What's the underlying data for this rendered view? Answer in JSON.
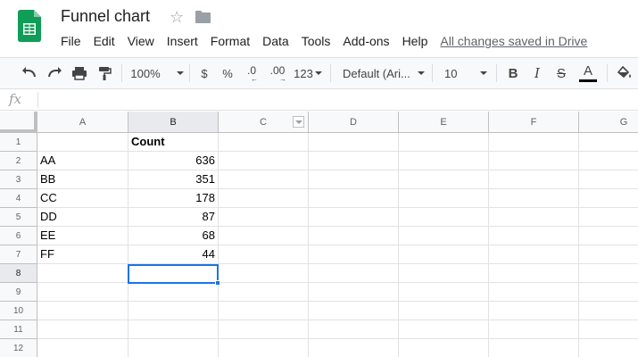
{
  "document": {
    "title": "Funnel chart",
    "saved_status": "All changes saved in Drive"
  },
  "menu": [
    "File",
    "Edit",
    "View",
    "Insert",
    "Format",
    "Data",
    "Tools",
    "Add-ons",
    "Help"
  ],
  "toolbar": {
    "zoom": "100%",
    "currency": "$",
    "percent": "%",
    "decrease_decimal": ".0",
    "increase_decimal": ".00",
    "more_formats": "123",
    "font": "Default (Ari...",
    "font_size": "10",
    "bold": "B",
    "italic": "I",
    "strike": "S",
    "text_color_letter": "A",
    "text_color": "#000000"
  },
  "formula_bar": {
    "label": "fx",
    "value": ""
  },
  "columns": [
    "A",
    "B",
    "C",
    "D",
    "E",
    "F",
    "G"
  ],
  "rows": [
    "1",
    "2",
    "3",
    "4",
    "5",
    "6",
    "7",
    "8",
    "9",
    "10",
    "11",
    "12"
  ],
  "cells": {
    "B1": "Count",
    "A2": "AA",
    "B2": "636",
    "A3": "BB",
    "B3": "351",
    "A4": "CC",
    "B4": "178",
    "A5": "DD",
    "B5": "87",
    "A6": "EE",
    "B6": "68",
    "A7": "FF",
    "B7": "44"
  },
  "selected_cell": "B8",
  "colors": {
    "accent": "#1a73e8",
    "logo_green": "#0f9d58"
  }
}
